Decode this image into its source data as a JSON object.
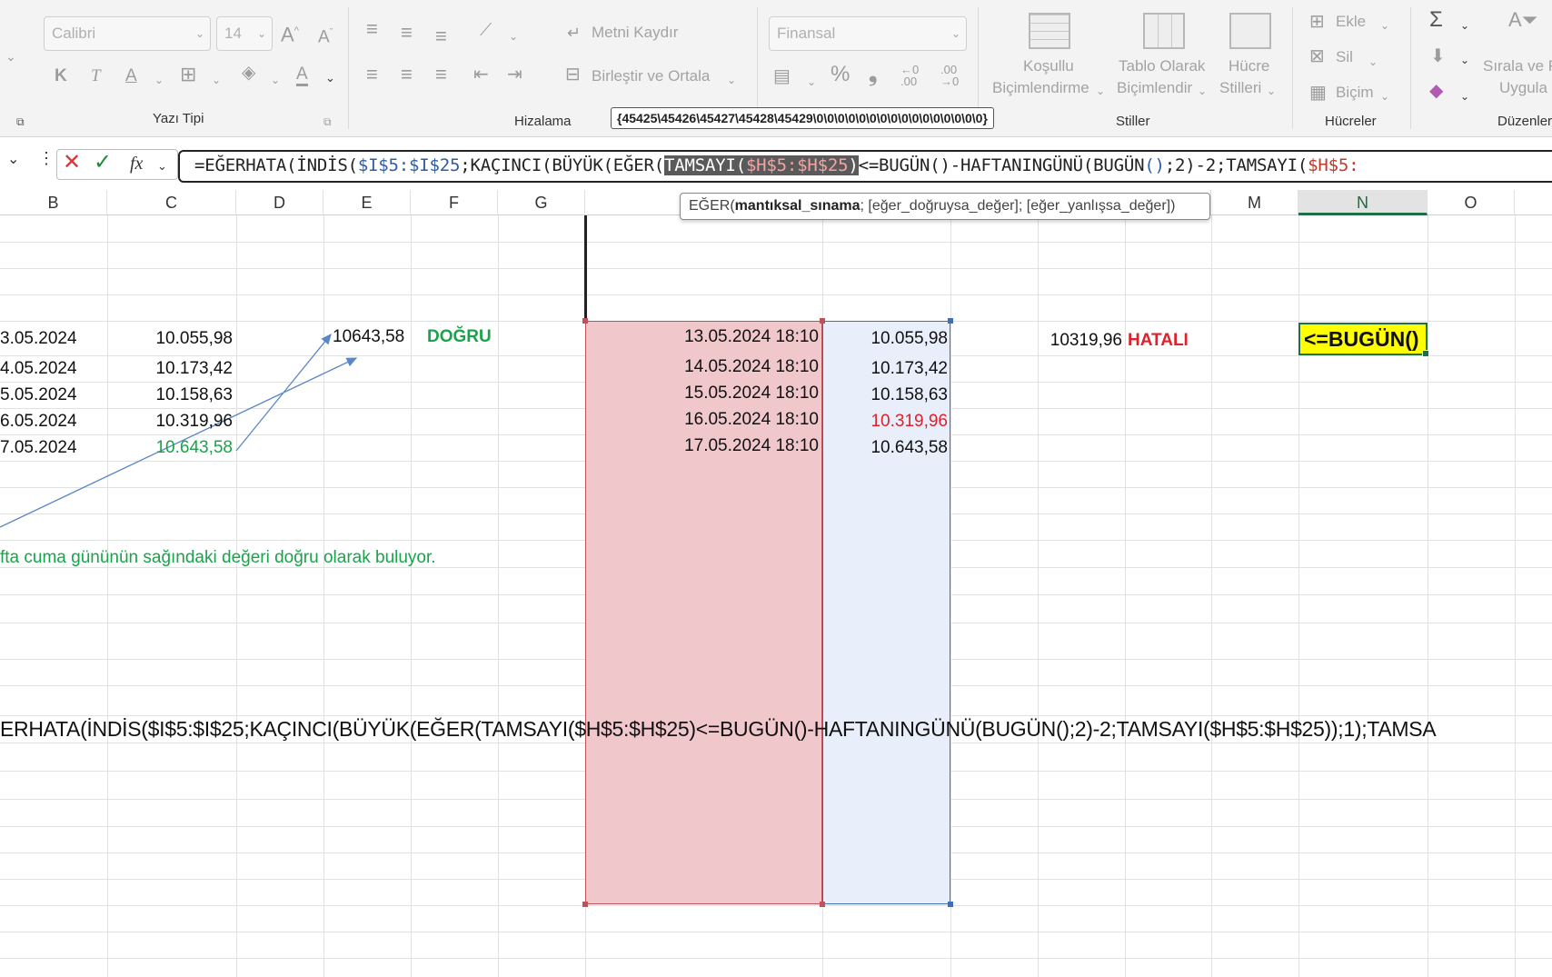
{
  "ribbon": {
    "font_name": "Calibri",
    "font_size": "14",
    "grow_font": "A",
    "shrink_font": "A",
    "bold": "K",
    "italic": "T",
    "underline": "A",
    "font_color": "A",
    "wrap_text": "Metni Kaydır",
    "merge_center": "Birleştir ve Ortala",
    "number_format": "Finansal",
    "percent": "%",
    "comma": "❟",
    "cond_format_1": "Koşullu",
    "cond_format_2": "Biçimlendirme",
    "table_format_1": "Tablo Olarak",
    "table_format_2": "Biçimlendir",
    "cell_styles_1": "Hücre",
    "cell_styles_2": "Stilleri",
    "insert": "Ekle",
    "delete": "Sil",
    "format": "Biçim",
    "sort_filter_1": "Sırala ve F",
    "sort_filter_2": "Uygula",
    "group_font": "Yazı Tipi",
    "group_align": "Hizalama",
    "group_styles": "Stiller",
    "group_cells": "Hücreler",
    "group_edit": "Düzenler",
    "array_tooltip": "{45425\\45426\\45427\\45428\\45429\\0\\0\\0\\0\\0\\0\\0\\0\\0\\0\\0\\0\\0\\0\\0\\0}"
  },
  "formula_bar": {
    "fx": "fx",
    "p1": "=EĞERHATA(",
    "p2": "İNDİS(",
    "p3": "$I$5:$I$25",
    "p4": ";KAÇINCI(BÜYÜK(EĞER",
    "p5": "(",
    "p6": "TAMSAYI(",
    "p7": "$H$5:$H$25",
    "p8": ")",
    "p9": "<=BUGÜN",
    "p10": "()",
    "p11": "-HAFTANINGÜNÜ",
    "p12": "(",
    "p13": "BUGÜN",
    "p14": "()",
    "p15": ";2)-2;TAMSAYI(",
    "p16": "$H$5:"
  },
  "arg_tooltip": {
    "fn": "EĞER(",
    "arg1": "mantıksal_sınama",
    "rest": "; [eğer_doğruysa_değer]; [eğer_yanlışsa_değer])"
  },
  "columns": [
    "B",
    "C",
    "D",
    "E",
    "F",
    "G",
    "M",
    "N",
    "O"
  ],
  "cells": {
    "b5": "3.05.2024",
    "b6": "4.05.2024",
    "b7": "5.05.2024",
    "b8": "6.05.2024",
    "b9": "7.05.2024",
    "c5": "10.055,98",
    "c6": "10.173,42",
    "c7": "10.158,63",
    "c8": "10.319,96",
    "c9": "10.643,58",
    "e5": "10643,58",
    "f5": "DOĞRU",
    "h5": "13.05.2024 18:10",
    "h6": "14.05.2024 18:10",
    "h7": "15.05.2024 18:10",
    "h8": "16.05.2024 18:10",
    "h9": "17.05.2024 18:10",
    "i5": "10.055,98",
    "i6": "10.173,42",
    "i7": "10.158,63",
    "i8": "10.319,96",
    "i9": "10.643,58",
    "k5": "10319,96",
    "l5": "HATALI",
    "n5": "<=BUGÜN()",
    "note": "fta cuma gününün sağındaki değeri doğru olarak buluyor.",
    "formula_text": "ERHATA(İNDİS($I$5:$I$25;KAÇINCI(BÜYÜK(EĞER(TAMSAYI($H$5:$H$25)<=BUGÜN()-HAFTANINGÜNÜ(BUGÜN();2)-2;TAMSAYI($H$5:$H$25));1);TAMSA"
  },
  "colors": {
    "green": "#1aa34a",
    "red": "#e0202a",
    "highlight_yellow": "#ffff00",
    "range_pink": "#f0c8cc",
    "range_blue": "#e8eefa"
  }
}
